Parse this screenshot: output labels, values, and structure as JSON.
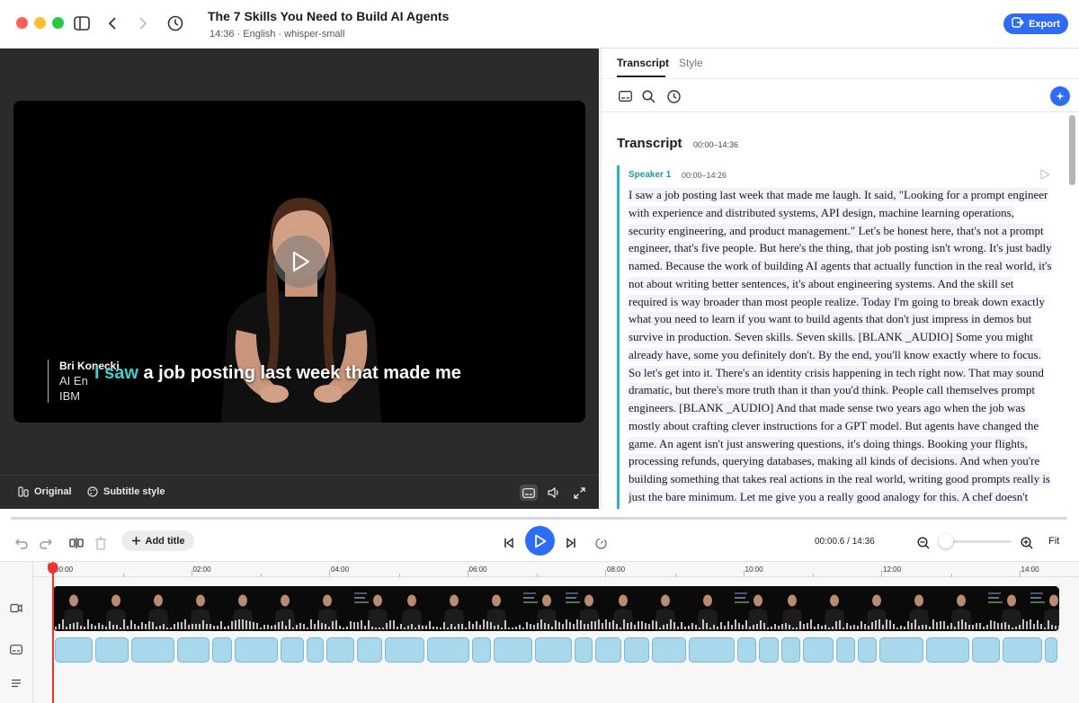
{
  "header": {
    "title": "The 7 Skills You Need to Build AI Agents",
    "subtitle": "14:36 · English · whisper-small",
    "export_label": "Export"
  },
  "video": {
    "caption_highlight": "I saw",
    "caption_rest": " a job posting last week that made me",
    "name_card": {
      "name": "Bri Konecki",
      "role": "AI En",
      "org": "IBM"
    },
    "bottom_bar": {
      "original_label": "Original",
      "subtitle_style_label": "Subtitle style"
    }
  },
  "side_panel": {
    "tabs": [
      {
        "label": "Transcript",
        "active": true
      },
      {
        "label": "Style",
        "active": false
      }
    ],
    "heading": "Transcript",
    "heading_range": "00:00–14:36",
    "segment": {
      "speaker": "Speaker 1",
      "time_range": "00:00–14:26",
      "text": "I saw a job posting last week that made me laugh. It said, \"Looking for a prompt engineer with experience and distributed systems, API design, machine learning operations, security engineering, and product management.\" Let's be honest here, that's not a prompt engineer, that's five people. But here's the thing, that job posting isn't wrong. It's just badly named. Because the work of building AI agents that actually function in the real world, it's not about writing better sentences, it's about engineering systems. And the skill set required is way broader than most people realize. Today I'm going to break down exactly what you need to learn if you want to build agents that don't just impress in demos but survive in production. Seven skills. Seven skills. [BLANK _AUDIO] Some you might already have, some you definitely don't. By the end, you'll know exactly where to focus. So let's get into it. There's an identity crisis happening in tech right now. That may sound dramatic, but there's more truth than it than you'd think. People call themselves prompt engineers. [BLANK _AUDIO] And that made sense two years ago when the job was mostly about crafting clever instructions for a GPT model. But agents have changed the game. An agent isn't just answering questions, it's doing things. Booking your flights, processing refunds, querying databases, making all kinds of decisions. And when you're building something that takes real actions in the real world, writing good prompts really is just the bare minimum. Let me give you a really good analogy for this. A chef doesn't"
    }
  },
  "toolbar": {
    "add_title_label": "Add title",
    "current_time": "00:00.6",
    "total_time": "14:36",
    "time_separator": " / ",
    "fit_label": "Fit",
    "zoom_level": 0.05
  },
  "timeline": {
    "ruler_labels": [
      "00:00",
      "02:00",
      "04:00",
      "06:00",
      "08:00",
      "10:00",
      "12:00",
      "14:00"
    ],
    "playhead_time": "00:00.6"
  },
  "colors": {
    "accent": "#2f6cf6",
    "caption_highlight": "#3ccfcf",
    "speaker": "#1d9aa8",
    "playhead": "#ee3333",
    "subtitle_clip": "#a9d7ec"
  },
  "icons": [
    "sidebar-toggle-icon",
    "back-arrow-icon",
    "forward-arrow-icon",
    "history-icon",
    "export-icon",
    "play-icon",
    "original-icon",
    "palette-icon",
    "subtitles-icon",
    "volume-icon",
    "fullscreen-icon",
    "search-icon",
    "clock-icon",
    "sparkle-icon",
    "undo-icon",
    "redo-icon",
    "split-icon",
    "trash-icon",
    "plus-icon",
    "skip-back-icon",
    "skip-forward-icon",
    "speed-icon",
    "zoom-out-icon",
    "zoom-in-icon",
    "video-track-icon",
    "subtitle-track-icon",
    "text-track-icon"
  ]
}
